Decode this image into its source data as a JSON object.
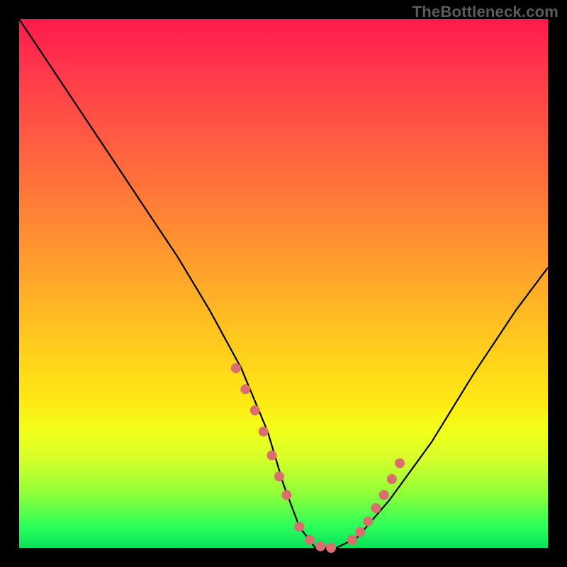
{
  "watermark": "TheBottleneck.com",
  "chart_data": {
    "type": "line",
    "title": "",
    "xlabel": "",
    "ylabel": "",
    "xlim": [
      0,
      100
    ],
    "ylim": [
      0,
      100
    ],
    "curve": {
      "name": "bottleneck-curve",
      "x": [
        0,
        6,
        12,
        18,
        24,
        30,
        36,
        42,
        47,
        50,
        53,
        56,
        60,
        64,
        70,
        78,
        86,
        94,
        100
      ],
      "y": [
        100,
        91,
        82,
        73,
        64,
        55,
        45,
        34,
        22,
        12,
        4,
        0,
        0,
        2,
        9,
        20,
        33,
        45,
        53
      ]
    },
    "highlight_points": {
      "name": "highlight-dots",
      "color": "#d86e6e",
      "x": [
        41.0,
        42.8,
        44.6,
        46.2,
        47.8,
        49.2,
        50.6,
        53.0,
        55.0,
        57.0,
        59.0,
        63.0,
        64.5,
        66.0,
        67.5,
        69.0,
        70.5,
        72.0
      ],
      "y": [
        34.0,
        30.0,
        26.0,
        22.0,
        17.5,
        13.5,
        10.0,
        4.0,
        1.5,
        0.3,
        0.0,
        1.5,
        3.0,
        5.0,
        7.5,
        10.0,
        13.0,
        16.0
      ]
    }
  }
}
